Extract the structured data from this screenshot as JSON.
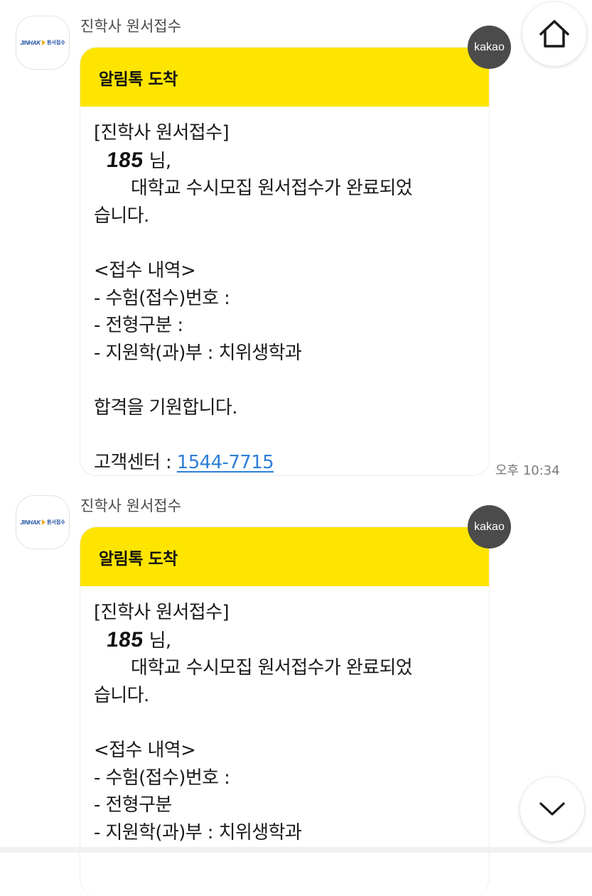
{
  "messages": [
    {
      "sender": "진학사 원서접수",
      "avatar_logo": {
        "brand": "JINHAK",
        "sub": "원서접수"
      },
      "header": "알림톡 도착",
      "badge": "kakao",
      "lines": {
        "org": "[진학사 원서접수]",
        "name_mark": "185",
        "name_suffix": "님,",
        "completed_1": "대학교 수시모집 원서접수가 완료되었",
        "completed_2": "습니다.",
        "section": "<접수 내역>",
        "exam_number": "- 수험(접수)번호 :",
        "admission_type": "- 전형구분 :",
        "department": "- 지원학(과)부 : 치위생학과",
        "wish": "합격을 기원합니다.",
        "support_label": "고객센터 : ",
        "support_phone": "1544-7715"
      },
      "time": "오후 10:34"
    },
    {
      "sender": "진학사 원서접수",
      "avatar_logo": {
        "brand": "JINHAK",
        "sub": "원서접수"
      },
      "header": "알림톡 도착",
      "badge": "kakao",
      "lines": {
        "org": "[진학사 원서접수]",
        "name_mark": "185",
        "name_suffix": "님,",
        "completed_1": "대학교 수시모집 원서접수가 완료되었",
        "completed_2": "습니다.",
        "section": "<접수 내역>",
        "exam_number": "- 수험(접수)번호 :",
        "admission_type": "- 전형구분",
        "department": "- 지원학(과)부 : 치위생학과"
      }
    }
  ],
  "controls": {
    "home_icon": "home-icon",
    "scroll_down_icon": "chevron-down-icon"
  },
  "colors": {
    "header_yellow": "#fee500",
    "link_blue": "#2d7fd6",
    "badge_gray": "#4b4b4b"
  }
}
